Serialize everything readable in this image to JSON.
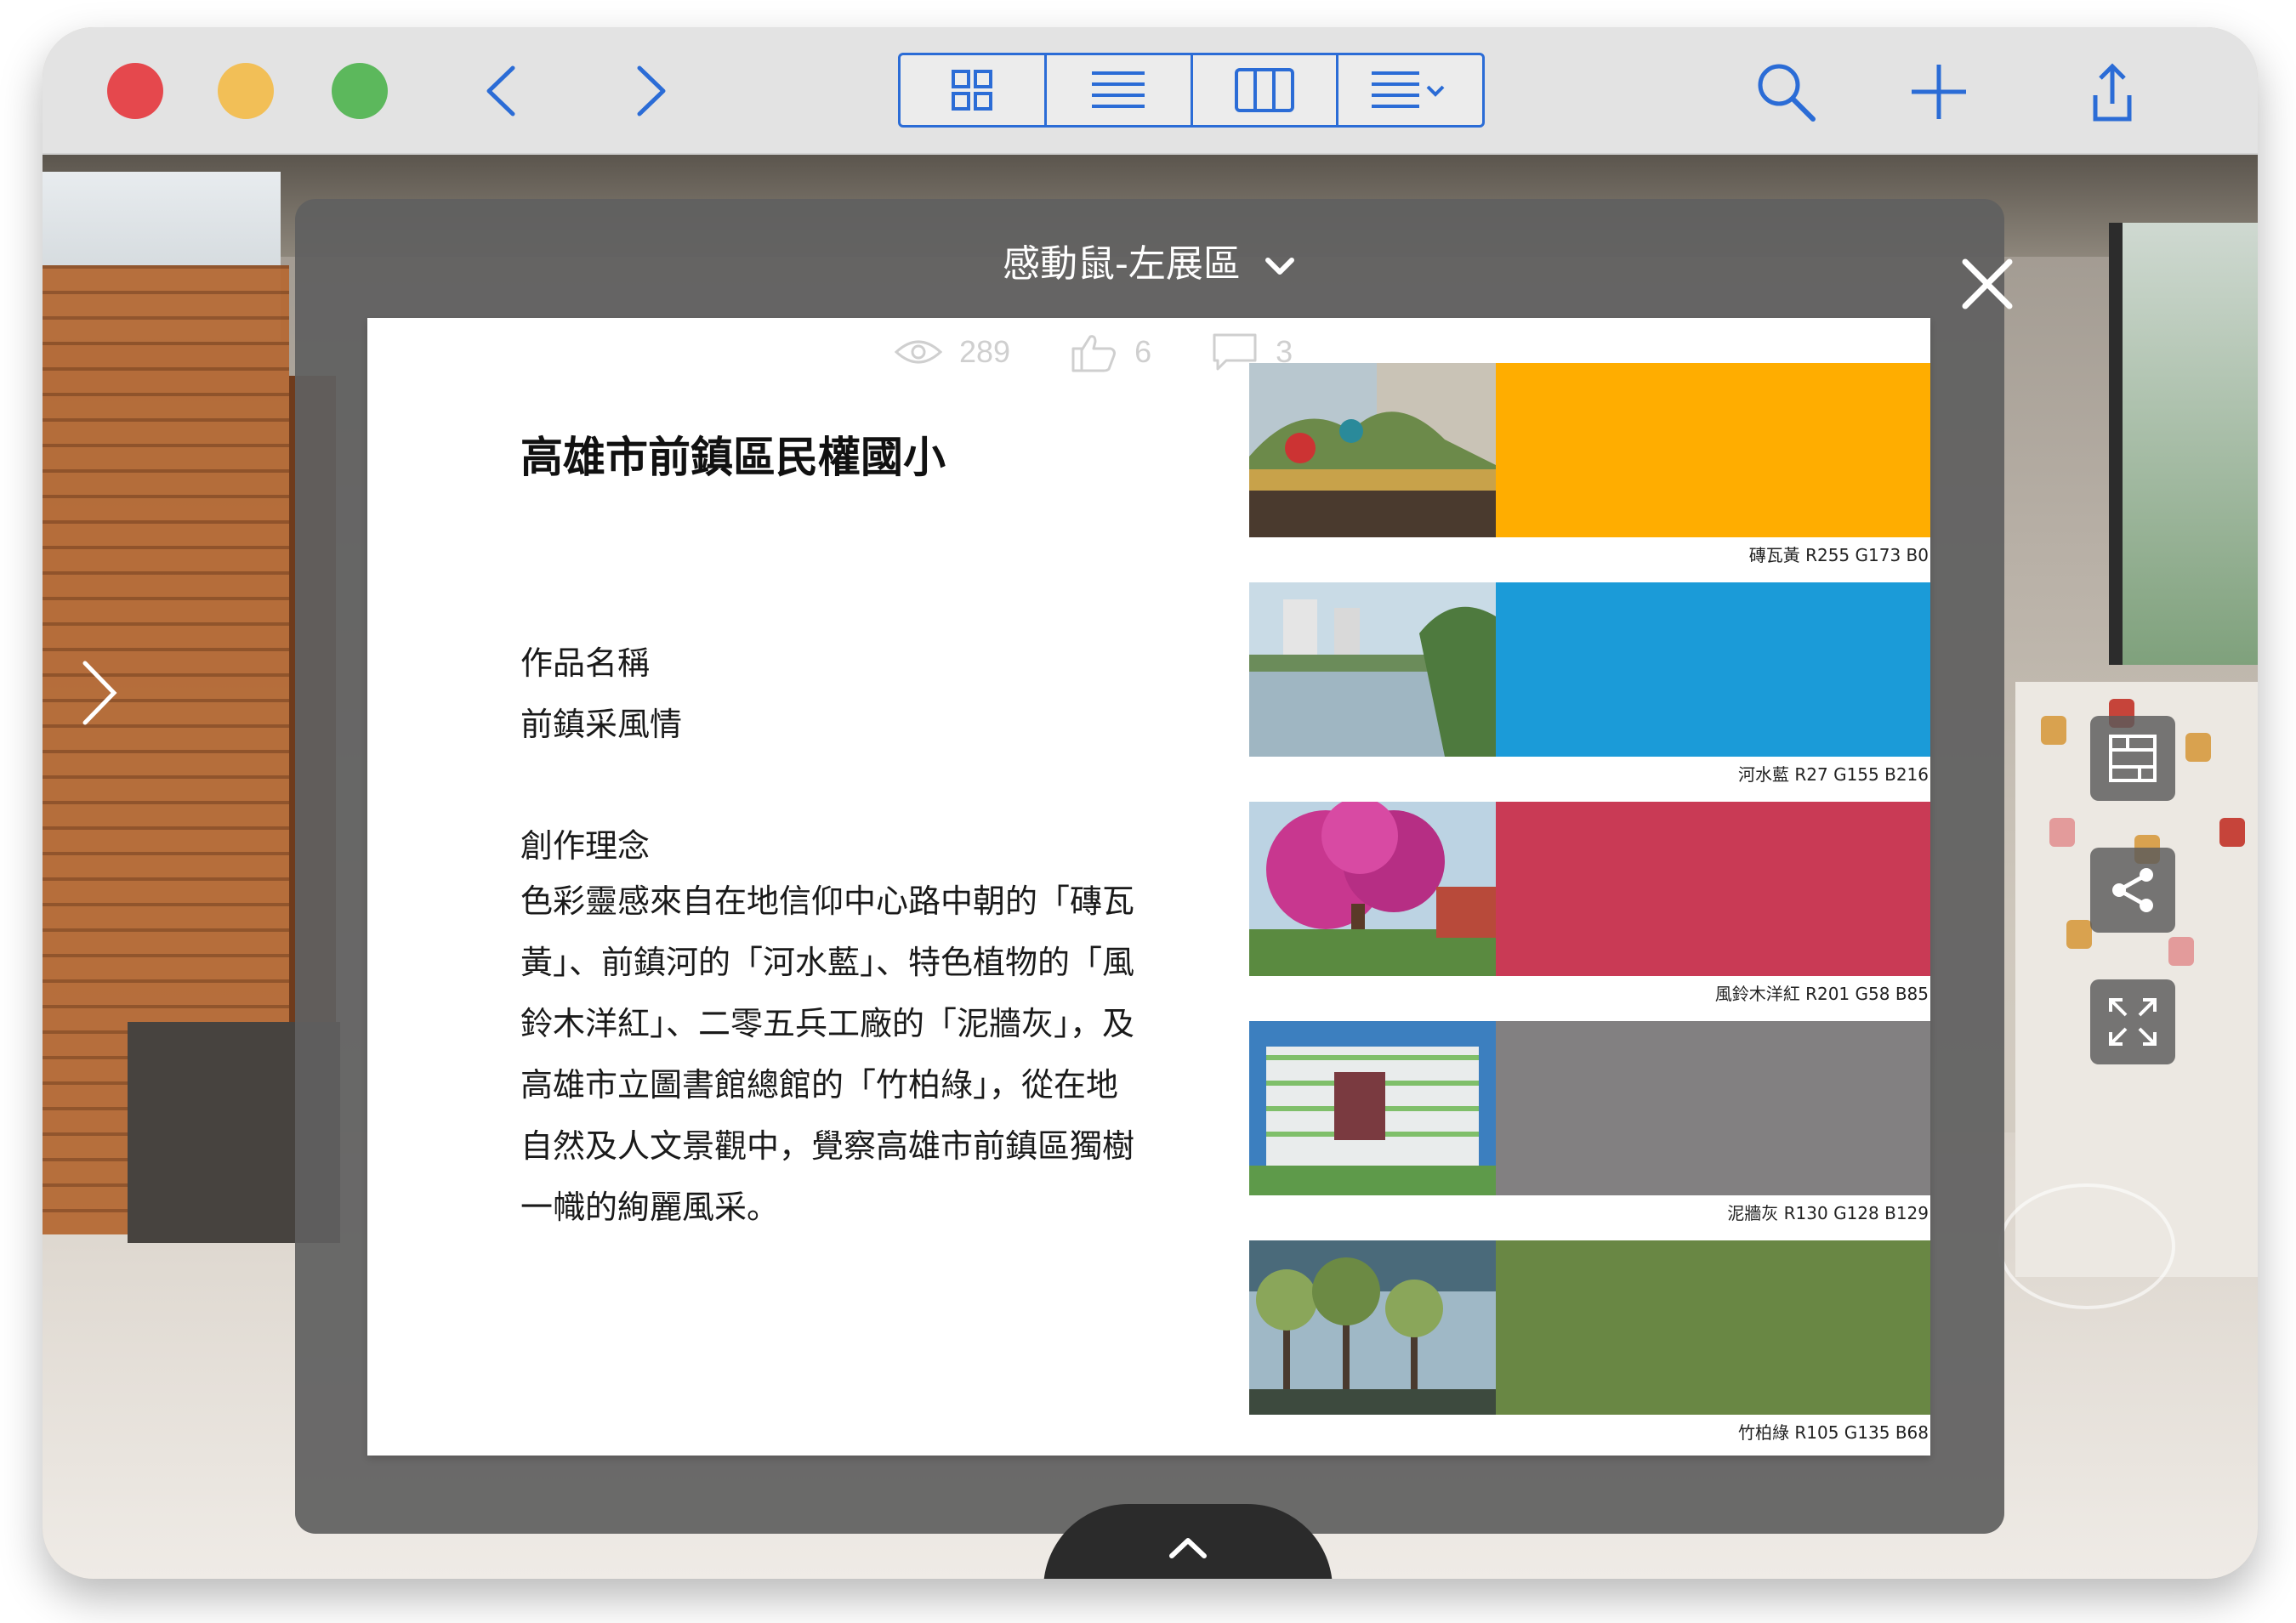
{
  "window": {
    "toolbar": {
      "icons": {
        "back": "chevron-left-icon",
        "forward": "chevron-right-icon",
        "search": "search-icon",
        "add": "plus-icon",
        "share": "share-icon"
      },
      "view_modes": [
        "grid-view-icon",
        "list-view-icon",
        "column-view-icon",
        "group-view-icon"
      ],
      "accent_color": "#2b6cd6"
    }
  },
  "modal": {
    "title": "感動鼠-左展區",
    "stats": {
      "views": "289",
      "likes": "6",
      "comments": "3"
    },
    "content": {
      "school": "高雄市前鎮區民權國小",
      "work_name_label": "作品名稱",
      "work_name": "前鎮采風情",
      "concept_label": "創作理念",
      "concept": "色彩靈感來自在地信仰中心路中朝的「磚瓦黃」、前鎮河的「河水藍」、特色植物的「風鈴木洋紅」、二零五兵工廠的「泥牆灰」，及高雄市立圖書館總館的「竹柏綠」，從在地自然及人文景觀中，覺察高雄市前鎮區獨樹一幟的絢麗風采。"
    },
    "swatches": [
      {
        "caption": "磚瓦黃 R255 G173 B0",
        "color": "#ffad00",
        "photo": "temple-photo"
      },
      {
        "caption": "河水藍 R27 G155 B216",
        "color": "#1b9bd8",
        "photo": "river-photo"
      },
      {
        "caption": "風鈴木洋紅 R201 G58 B85",
        "color": "#c93a55",
        "photo": "tree-photo"
      },
      {
        "caption": "泥牆灰 R130 G128 B129",
        "color": "#828081",
        "photo": "library-photo"
      },
      {
        "caption": "竹柏綠 R105 G135 B68",
        "color": "#698744",
        "photo": "forest-photo"
      }
    ]
  }
}
